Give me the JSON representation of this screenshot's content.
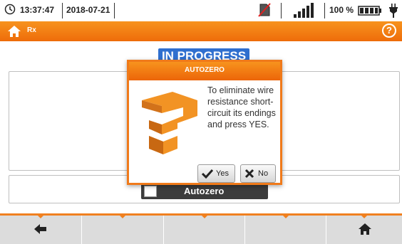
{
  "status_bar": {
    "time": "13:37:47",
    "date": "2018-07-21",
    "battery_percent": "100 %",
    "icons": [
      "clock-icon",
      "sd-card-crossed-icon",
      "signal-icon",
      "battery-icon",
      "power-plug-icon"
    ]
  },
  "title_bar": {
    "mode_label": "Rx",
    "icons": [
      "home-icon",
      "help-icon"
    ]
  },
  "main": {
    "progress_label": "IN PROGRESS",
    "autozero_toggle_label": "Autozero"
  },
  "dialog": {
    "title": "AUTOZERO",
    "message": "To eliminate wire resistance short-circuit its endings and press YES.",
    "yes_label": "Yes",
    "no_label": "No"
  },
  "bottom_bar": {
    "icons": [
      "back-arrow-icon",
      "home-icon"
    ]
  },
  "colors": {
    "accent_orange": "#f07a1a",
    "progress_blue": "#2f6fcf",
    "bottom_bar_gray": "#dcdcdc"
  }
}
